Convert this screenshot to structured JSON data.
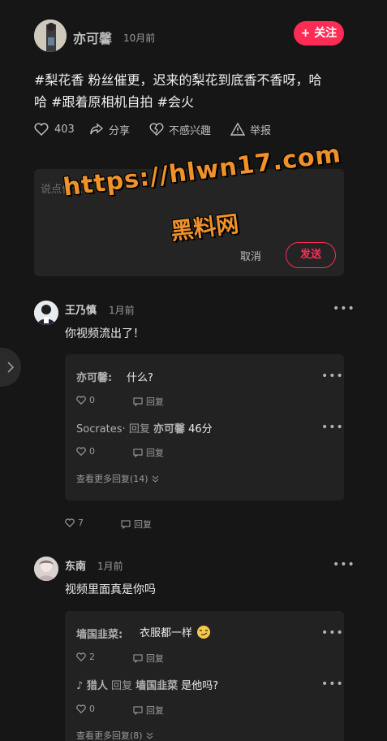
{
  "post": {
    "author": "亦可馨",
    "time": "10月前",
    "follow_label": "+ 关注",
    "content_line1": "#梨花香 粉丝催更，迟来的梨花到底香不香呀，哈",
    "content_line2": "哈 #跟着原相机自拍 #会火",
    "likes": "403",
    "share_label": "分享",
    "dislike_label": "不感兴趣",
    "report_label": "举报"
  },
  "compose": {
    "placeholder": "说点什么...",
    "cancel_label": "取消",
    "send_label": "发送"
  },
  "watermark": {
    "line1": "https://hlwn17.com",
    "line2": "黑料网"
  },
  "comments": [
    {
      "author": "王乃慎",
      "time": "1月前",
      "text": "你视频流出了！",
      "likes": "7",
      "reply_label": "回复",
      "replies": [
        {
          "author": "亦可馨:",
          "text": "什么?",
          "likes": "0",
          "reply_label": "回复"
        },
        {
          "author": "Socrates·",
          "reply_word": "回复",
          "target": "亦可馨",
          "text": "46分",
          "likes": "0",
          "reply_label": "回复"
        }
      ],
      "more_replies": "查看更多回复(14)"
    },
    {
      "author": "东南",
      "time": "1月前",
      "text": "视频里面真是你吗",
      "replies": [
        {
          "author": "墙国韭菜:",
          "text": "衣服都一样",
          "likes": "2",
          "reply_label": "回复"
        },
        {
          "author": "♪ 猎人",
          "reply_word": "回复",
          "target": "墙国韭菜",
          "text": "是他吗?",
          "likes": "0",
          "reply_label": "回复"
        }
      ],
      "more_replies": "查看更多回复(8)"
    }
  ],
  "colors": {
    "background": "#161616",
    "accent": "#fe2c55",
    "watermark": "#f0912a"
  }
}
